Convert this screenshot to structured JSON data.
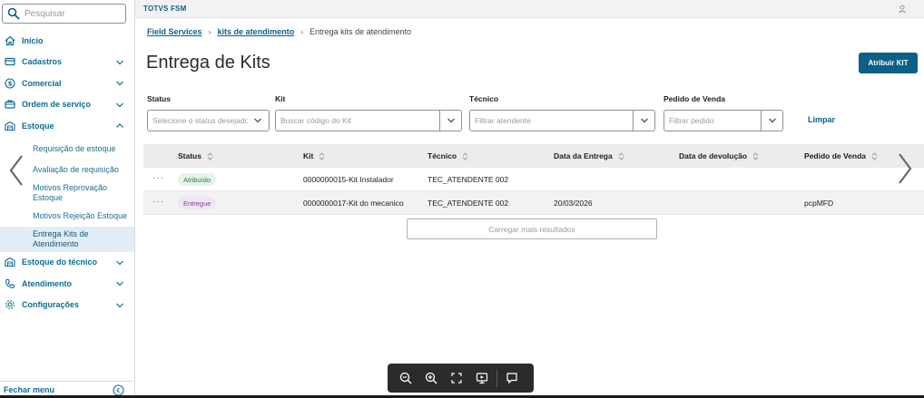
{
  "sidebar": {
    "search_placeholder": "Pesquisar",
    "items": [
      {
        "label": "Início"
      },
      {
        "label": "Cadastros"
      },
      {
        "label": "Comercial"
      },
      {
        "label": "Ordem de serviço"
      },
      {
        "label": "Estoque"
      },
      {
        "label": "Estoque do técnico"
      },
      {
        "label": "Atendimento"
      },
      {
        "label": "Configurações"
      }
    ],
    "estoque_sub": [
      {
        "label": "Requisição de estoque"
      },
      {
        "label": "Avaliação de requisição"
      },
      {
        "label": "Motivos Reprovação Estoque"
      },
      {
        "label": "Motivos Rejeição Estoque"
      },
      {
        "label": "Entrega Kits de Atendimento"
      }
    ],
    "footer_label": "Fechar menu"
  },
  "header": {
    "app_title": "TOTVS FSM"
  },
  "breadcrumb": {
    "items": [
      {
        "label": "Field Services"
      },
      {
        "label": "kits de atendimento"
      },
      {
        "label": "Entrega kits de atendimento"
      }
    ]
  },
  "page": {
    "title": "Entrega de Kits",
    "primary_action": "Atribuir KIT"
  },
  "filters": {
    "status": {
      "label": "Status",
      "placeholder": "Selecione o status desejado"
    },
    "kit": {
      "label": "Kit",
      "placeholder": "Buscar código do Kit"
    },
    "tecnico": {
      "label": "Técnico",
      "placeholder": "Filtrar atendente"
    },
    "pedido": {
      "label": "Pedido de Venda",
      "placeholder": "Filtrar pedido"
    },
    "clear_label": "Limpar"
  },
  "table": {
    "columns": [
      {
        "label": "Status"
      },
      {
        "label": "Kit"
      },
      {
        "label": "Técnico"
      },
      {
        "label": "Data da Entrega"
      },
      {
        "label": "Data de devolução"
      },
      {
        "label": "Pedido de Venda"
      }
    ],
    "rows": [
      {
        "more": "···",
        "status": "Atribuído",
        "kit": "0000000015-Kit Instalador",
        "tecnico": "TEC_ATENDENTE 002",
        "data_entrega": "",
        "data_devolucao": "",
        "pedido": ""
      },
      {
        "more": "···",
        "status": "Entregue",
        "kit": "0000000017-Kit do mecanico",
        "tecnico": "TEC_ATENDENTE 002",
        "data_entrega": "20/03/2026",
        "data_devolucao": "",
        "pedido": "pcpMFD"
      }
    ],
    "load_more_label": "Carregar mais resultados"
  },
  "colors": {
    "brand": "#0c5f87",
    "badge_atribuido_bg": "#e3f4e8",
    "badge_atribuido_text": "#2e7d4a",
    "badge_entregue_bg": "#f1e6f5",
    "badge_entregue_text": "#7b3f8f"
  },
  "icons": {
    "search": "search-icon",
    "home": "home-icon",
    "cadastros": "card-icon",
    "comercial": "dollar-icon",
    "ordem": "toolbox-icon",
    "estoque": "warehouse-icon",
    "tecnico_estoque": "warehouse-icon",
    "atendimento": "phone-icon",
    "configuracoes": "gear-icon",
    "user": "user-icon",
    "viewer": [
      "zoom-out-icon",
      "zoom-in-icon",
      "fullscreen-icon",
      "presentation-icon",
      "comment-icon"
    ]
  }
}
